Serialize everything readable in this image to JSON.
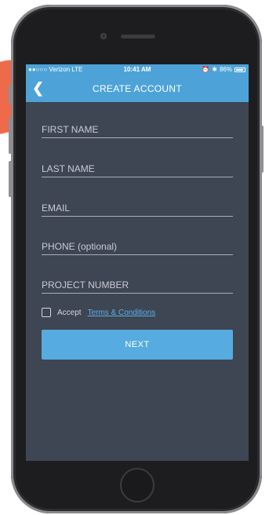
{
  "status_bar": {
    "carrier": "●●○○○ Verizon  LTE",
    "time": "10:41 AM",
    "battery": "86%"
  },
  "nav": {
    "back_icon": "chevron-left-icon",
    "title": "CREATE ACCOUNT"
  },
  "form": {
    "first_name_placeholder": "FIRST NAME",
    "last_name_placeholder": "LAST NAME",
    "email_placeholder": "EMAIL",
    "phone_placeholder": "PHONE (optional)",
    "project_number_placeholder": "PROJECT NUMBER",
    "accept_label": "Accept",
    "terms_link": "Terms & Conditions",
    "accept_checked": false,
    "next_label": "NEXT"
  },
  "colors": {
    "accent": "#4da3d8",
    "screen_background": "#3e4553",
    "link": "#5ab0e6",
    "decorative_shape": "#ef6a4a"
  }
}
